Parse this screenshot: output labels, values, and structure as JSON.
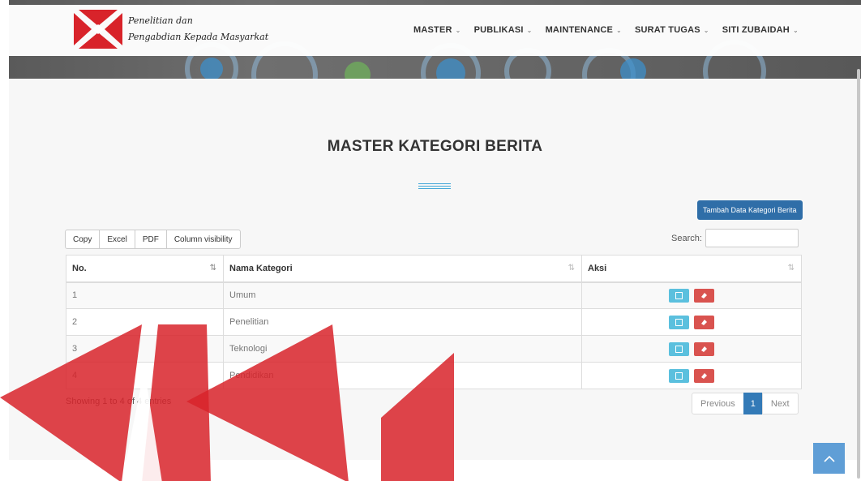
{
  "brand": {
    "line1": "Penelitian dan",
    "line2": "Pengabdian Kepada Masyarkat"
  },
  "nav": [
    {
      "label": "MASTER",
      "icon": "chevron-down-icon"
    },
    {
      "label": "PUBLIKASI",
      "icon": "chevron-down-icon"
    },
    {
      "label": "MAINTENANCE",
      "icon": "chevron-down-icon"
    },
    {
      "label": "SURAT TUGAS",
      "icon": "chevron-down-icon"
    },
    {
      "label": "SITI ZUBAIDAH",
      "icon": "chevron-down-icon"
    }
  ],
  "page": {
    "title": "MASTER KATEGORI BERITA",
    "add_button": "Tambah Data Kategori Berita"
  },
  "export_buttons": [
    "Copy",
    "Excel",
    "PDF",
    "Column visibility"
  ],
  "search": {
    "label": "Search:",
    "value": ""
  },
  "table": {
    "columns": [
      "No.",
      "Nama Kategori",
      "Aksi"
    ],
    "rows": [
      {
        "no": "1",
        "name": "Umum"
      },
      {
        "no": "2",
        "name": "Penelitian"
      },
      {
        "no": "3",
        "name": "Teknologi"
      },
      {
        "no": "4",
        "name": "Pendidikan"
      }
    ],
    "row_actions": [
      {
        "name": "edit",
        "icon": "edit-icon",
        "color": "#5bc0de"
      },
      {
        "name": "delete",
        "icon": "eraser-icon",
        "color": "#d9534f"
      }
    ]
  },
  "footer": {
    "info": "Showing 1 to 4 of 4 entries",
    "previous": "Previous",
    "current_page": "1",
    "next": "Next"
  },
  "colors": {
    "primary": "#2f6ea8",
    "edit": "#5bc0de",
    "delete": "#d9534f",
    "back_to_top": "#5f9ed6"
  }
}
